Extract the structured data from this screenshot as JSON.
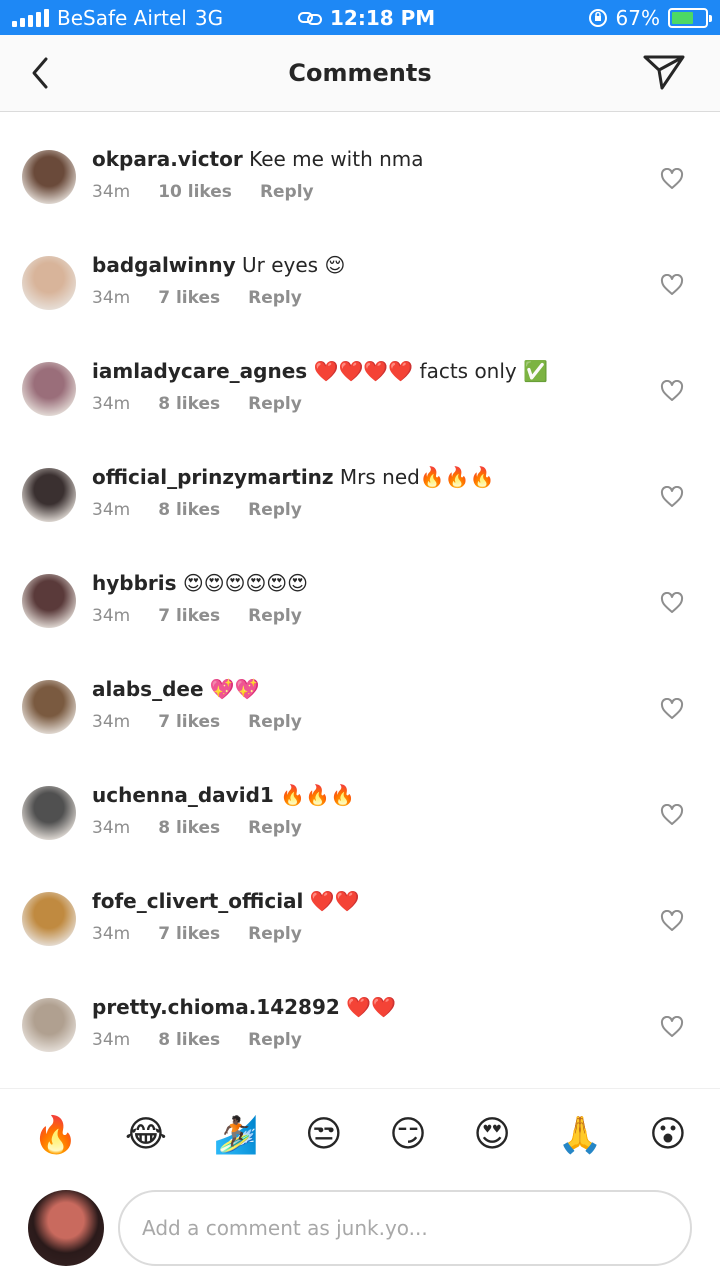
{
  "status_bar": {
    "carrier": "BeSafe Airtel",
    "network": "3G",
    "time": "12:18 PM",
    "battery": "67%",
    "battery_level": 0.67
  },
  "header": {
    "title": "Comments"
  },
  "comments": [
    {
      "user": "okpara.victor",
      "text": "Kee me with nma",
      "time": "34m",
      "likes": "10 likes",
      "reply": "Reply",
      "avatar_color": "#6a4a3a"
    },
    {
      "user": "badgalwinny",
      "text": "Ur eyes 😌",
      "time": "34m",
      "likes": "7 likes",
      "reply": "Reply",
      "avatar_color": "#d8b49a"
    },
    {
      "user": "iamladycare_agnes",
      "text": "❤️❤️❤️❤️ facts only ✅",
      "time": "34m",
      "likes": "8 likes",
      "reply": "Reply",
      "avatar_color": "#9a6e7a"
    },
    {
      "user": "official_prinzymartinz",
      "text": "Mrs ned🔥🔥🔥",
      "time": "34m",
      "likes": "8 likes",
      "reply": "Reply",
      "avatar_color": "#3a3030"
    },
    {
      "user": "hybbris",
      "text": "😍😍😍😍😍😍",
      "time": "34m",
      "likes": "7 likes",
      "reply": "Reply",
      "avatar_color": "#5a3a3a"
    },
    {
      "user": "alabs_dee",
      "text": "💖💖",
      "time": "34m",
      "likes": "7 likes",
      "reply": "Reply",
      "avatar_color": "#7a5a40"
    },
    {
      "user": "uchenna_david1",
      "text": "🔥🔥🔥",
      "time": "34m",
      "likes": "8 likes",
      "reply": "Reply",
      "avatar_color": "#505050"
    },
    {
      "user": "fofe_clivert_official",
      "text": "❤️❤️",
      "time": "34m",
      "likes": "7 likes",
      "reply": "Reply",
      "avatar_color": "#c08a40"
    },
    {
      "user": "pretty.chioma.142892",
      "text": "❤️❤️",
      "time": "34m",
      "likes": "8 likes",
      "reply": "Reply",
      "avatar_color": "#b0a090"
    }
  ],
  "emoji_bar": [
    "🔥",
    "😂",
    "🏄🏿",
    "😒",
    "😏",
    "😍",
    "🙏",
    "😮"
  ],
  "composer": {
    "placeholder": "Add a comment as junk.yo..."
  }
}
